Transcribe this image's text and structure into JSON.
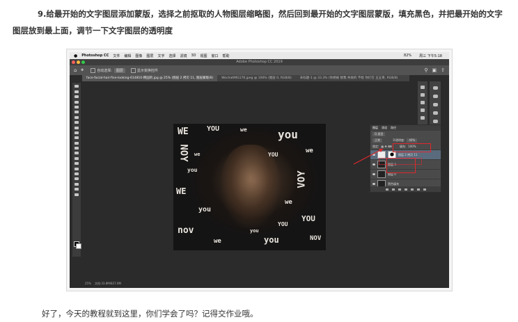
{
  "article": {
    "step_text": "9.给最开始的文字图层添加蒙版，选择之前抠取的人物图层缩略图，然后回到最开始的文字图层蒙版，填充黑色，并把最开始的文字图层放到最上面，调节一下文字图层的透明度",
    "closing_text": "好了，今天的教程就到这里，你们学会了吗？记得交作业哦。"
  },
  "screenshot": {
    "menubar": {
      "app": "Photoshop CC",
      "items": [
        "文件",
        "编辑",
        "图像",
        "图层",
        "文字",
        "选择",
        "滤镜",
        "3D",
        "视图",
        "窗口",
        "帮助"
      ],
      "status_right": [
        "82%",
        "周三 下午5:18"
      ]
    },
    "window_title": "Adobe Photoshop CC 2019",
    "options_bar": {
      "auto_select_label": "自动选择:",
      "auto_select_value": "图层",
      "show_transform_label": "显示变换控件"
    },
    "doc_tabs": [
      "face-facial-hair-fine-looking-614810-韩国的.jpg @ 25% (图层 2 拷贝 11, 图层蒙版/8)",
      "WechatIMG176.jpeg @ 100% (图层 0, RGB/8)",
      "未标题-1 @ 33.3% (你想被 替我 失败的 不给 你们在 五五哥, RGB/8)"
    ],
    "status_bar": {
      "zoom": "25%",
      "doc_info": "文档:33.8M/827.6M"
    },
    "canvas_words": [
      "WE",
      "YOU",
      "you",
      "we",
      "NOY",
      "you",
      "WE",
      "you",
      "VOY",
      "we",
      "YOU",
      "nov",
      "we",
      "you",
      "YOU",
      "we",
      "you",
      "NOV",
      "we",
      "YOU"
    ],
    "layers_panel": {
      "tabs": [
        "图层",
        "通道",
        "路径"
      ],
      "kind_label": "Q 类型",
      "blend_mode": "正常",
      "opacity_label": "不透明度:",
      "opacity_value": "40%",
      "lock_label": "锁定:",
      "fill_label": "填充:",
      "fill_value": "100%",
      "layers": [
        {
          "name": "图层 2 拷贝 11",
          "selected": true
        },
        {
          "name": "图层 3",
          "selected": false
        },
        {
          "name": "图层 0",
          "selected": false
        },
        {
          "name": "黑色填充",
          "selected": false
        }
      ]
    },
    "colors": {
      "highlight": "#e0282d",
      "ui_dark": "#2b2b2b",
      "panel": "#4a4a4a"
    }
  }
}
